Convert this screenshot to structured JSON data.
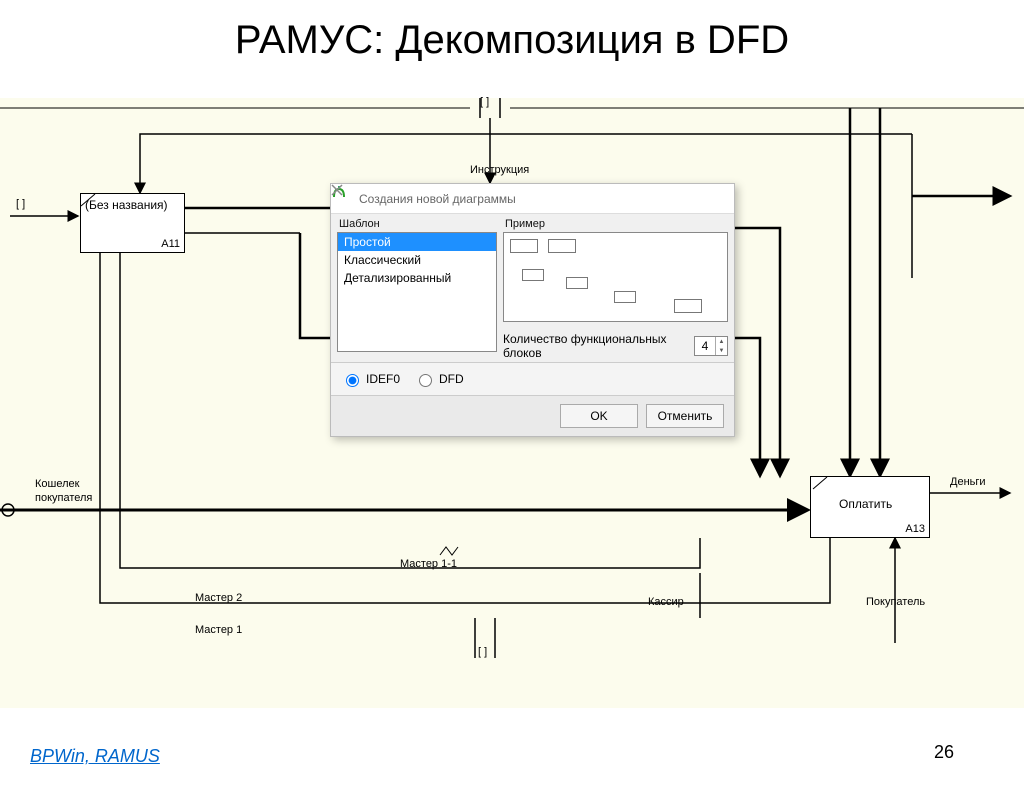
{
  "title": "РАМУС: Декомпозиция в DFD",
  "footer_link": "BPWin, RAMUS",
  "page_number": "26",
  "diagram": {
    "box_a11": {
      "label": "(Без названия)",
      "id": "A11"
    },
    "box_a13": {
      "label": "Оплатить",
      "id": "A13"
    },
    "labels": {
      "instruction": "Инструкция",
      "wallet_line1": "Кошелек",
      "wallet_line2": "покупателя",
      "money": "Деньги",
      "buyer": "Покупатель",
      "cashier": "Кассир",
      "master1": "Мастер 1",
      "master2": "Мастер 2",
      "master11": "Мастер 1-1",
      "bracket_top1": "[ ]",
      "bracket_top2": "[ ]",
      "bracket_left": "[ ]",
      "bracket_bottom": "[ ]"
    }
  },
  "dialog": {
    "title": "Создания новой диаграммы",
    "template_label": "Шаблон",
    "preview_label": "Пример",
    "templates": [
      "Простой",
      "Классический",
      "Детализированный"
    ],
    "selected_template_index": 0,
    "count_label": "Количество функциональных блоков",
    "count_value": "4",
    "radio_idef0": "IDEF0",
    "radio_dfd": "DFD",
    "ok": "OK",
    "cancel": "Отменить"
  }
}
